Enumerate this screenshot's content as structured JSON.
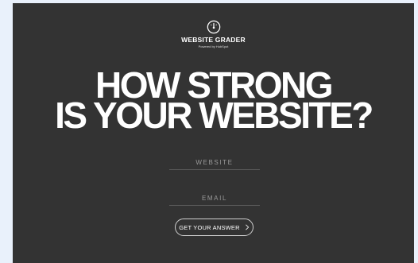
{
  "brand": {
    "name": "WEBSITE GRADER",
    "powered_by": "Powered by HubSpot"
  },
  "hero": {
    "line1": "HOW STRONG",
    "line2": "IS YOUR WEBSITE?"
  },
  "form": {
    "website_placeholder": "WEBSITE",
    "email_placeholder": "EMAIL",
    "submit_label": "GET YOUR ANSWER"
  },
  "colors": {
    "panel": "#333333",
    "page": "#e9f1fb",
    "text": "#ffffff"
  },
  "icons": {
    "logo": "gauge-icon",
    "submit": "chevron-right-icon"
  }
}
